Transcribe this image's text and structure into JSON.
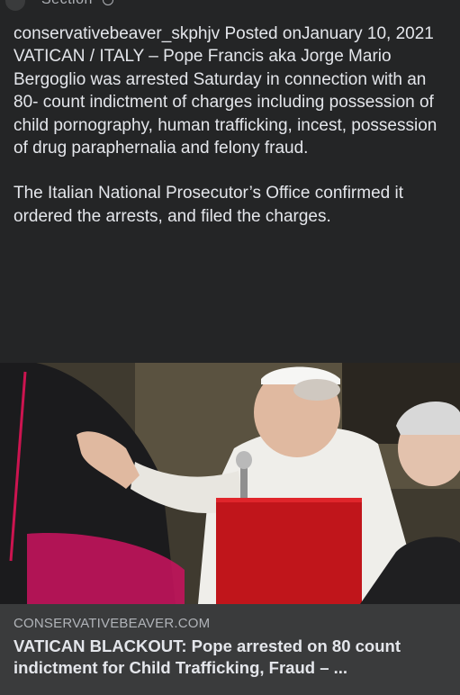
{
  "header": {
    "label": "Section"
  },
  "post": {
    "paragraph_1": "conservativebeaver_skphjv  Posted onJanuary 10, 2021 VATICAN / ITALY – Pope Francis aka Jorge Mario Bergoglio was arrested Saturday in connection with an 80- count indictment of charges including possession of child pornography, human trafficking, incest, possession of drug paraphernalia and felony fraud.",
    "paragraph_2": "The Italian National Prosecutor’s Office confirmed it ordered the arrests, and filed the charges."
  },
  "link_preview": {
    "domain": "CONSERVATIVEBEAVER.COM",
    "title": "VATICAN BLACKOUT: Pope arrested on 80 count indictment for Child Trafficking, Fraud – ..."
  },
  "colors": {
    "background": "#242526",
    "card_meta_background": "#3a3b3c",
    "text_primary": "#e4e6eb",
    "text_secondary": "#b0b3b8",
    "red_folder": "#c0151b",
    "cassock_black": "#1b1b1d",
    "white_vestment": "#efeeea"
  }
}
